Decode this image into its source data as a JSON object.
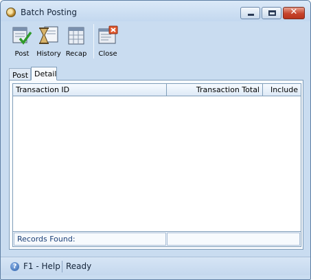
{
  "window": {
    "title": "Batch Posting"
  },
  "title_buttons": {
    "minimize_icon": "minimize-icon",
    "maximize_icon": "maximize-icon",
    "close_glyph": "✕"
  },
  "toolbar": {
    "post_label": "Post",
    "history_label": "History",
    "recap_label": "Recap",
    "close_label": "Close"
  },
  "tabs": [
    {
      "label": "Post",
      "active": false
    },
    {
      "label": "Detail",
      "active": true
    }
  ],
  "grid": {
    "columns": [
      "Transaction ID",
      "Transaction Total",
      "Include"
    ],
    "rows": [],
    "footer_label": "Records Found:"
  },
  "statusbar": {
    "help_label": "F1 - Help",
    "help_glyph": "?",
    "status": "Ready"
  },
  "colors": {
    "title_bar": "#c9dcf0",
    "accent_blue": "#1b3f76",
    "close_red": "#c6442c"
  }
}
